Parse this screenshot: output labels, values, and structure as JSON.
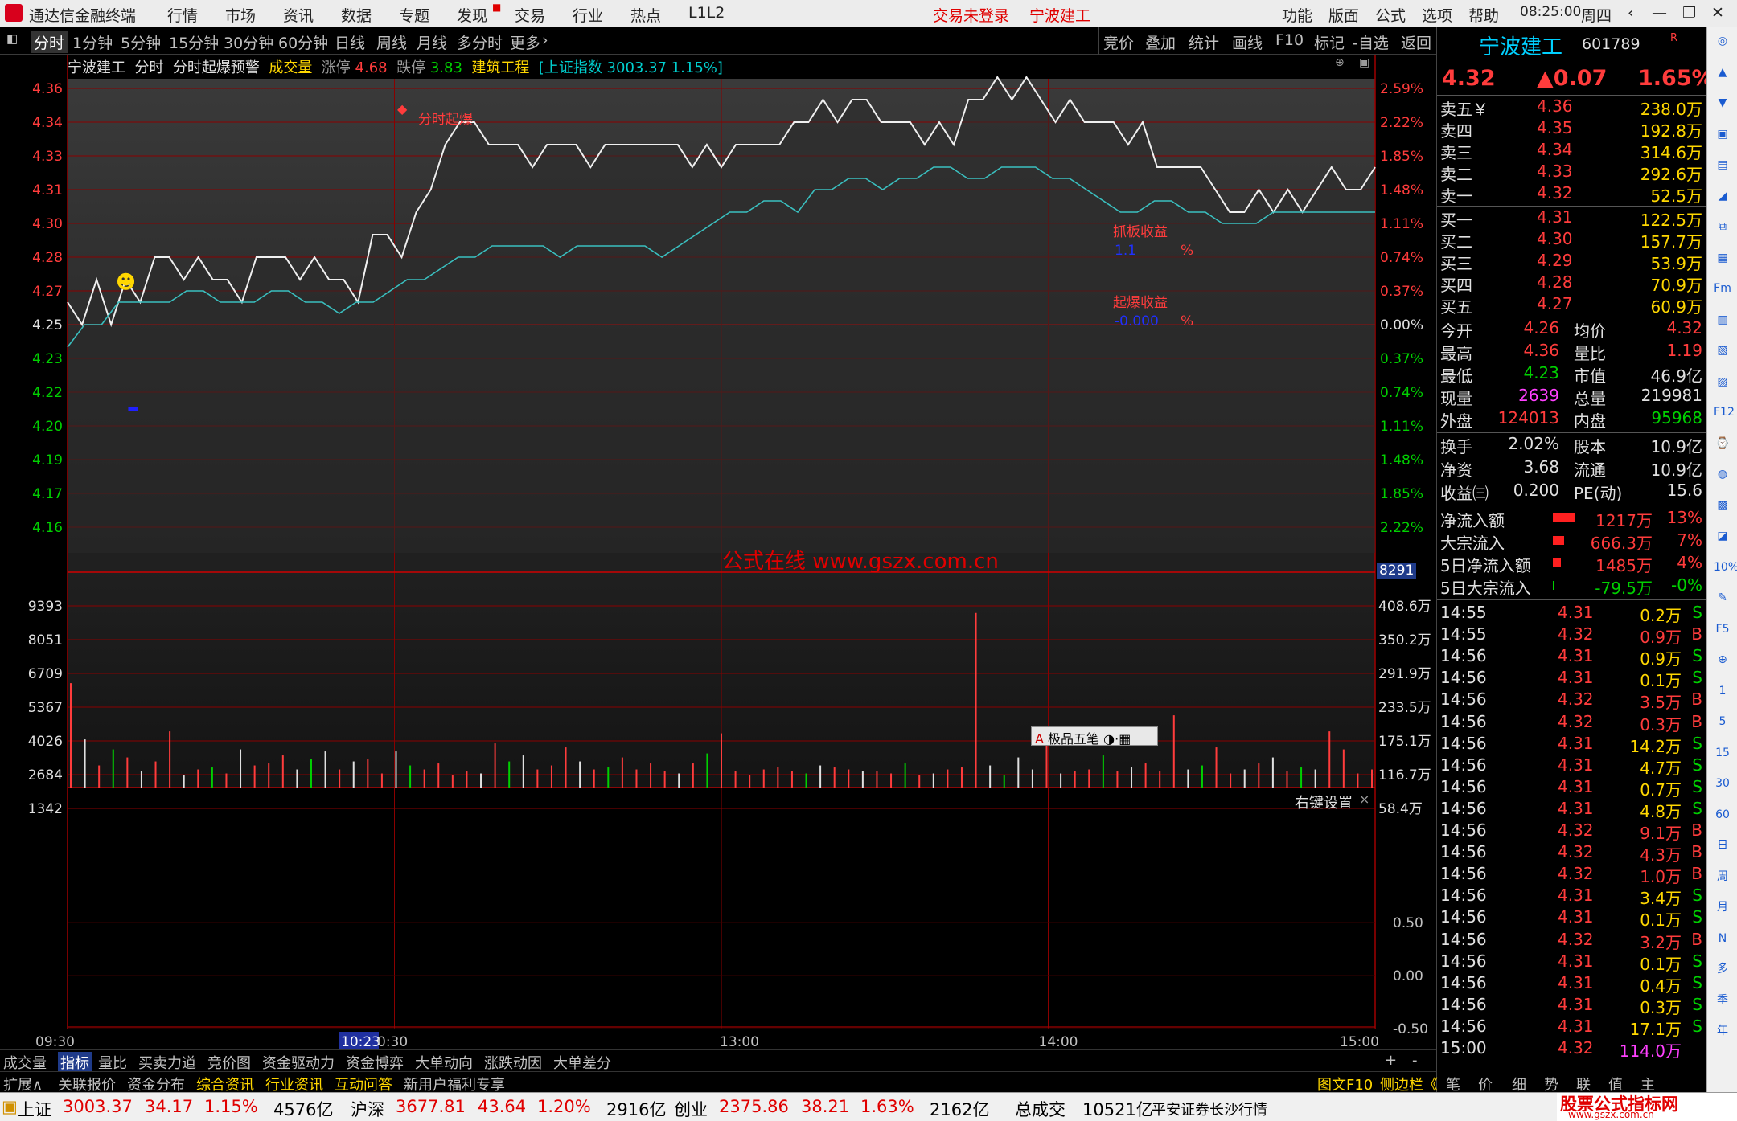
{
  "titlebar": {
    "app_title": "通达信金融终端",
    "menu": [
      "行情",
      "市场",
      "资讯",
      "数据",
      "专题",
      "发现",
      "交易",
      "行业",
      "热点",
      "L1L2"
    ],
    "login": "交易未登录",
    "stock": "宁波建工",
    "right_menu": [
      "功能",
      "版面",
      "公式",
      "选项",
      "帮助"
    ],
    "time": "08:25:00",
    "weekday": "周四"
  },
  "toolbar": {
    "periods": [
      "分时",
      "1分钟",
      "5分钟",
      "15分钟",
      "30分钟",
      "60分钟",
      "日线",
      "周线",
      "月线",
      "多分时",
      "更多"
    ],
    "actions": [
      "竞价",
      "叠加",
      "统计",
      "画线",
      "F10",
      "标记",
      "-自选",
      "返回"
    ]
  },
  "chart_header": {
    "name": "宁波建工",
    "period": "分时",
    "indicator": "分时起爆预警",
    "volume_label": "成交量",
    "limit_up_label": "涨停",
    "limit_up": "4.68",
    "limit_down_label": "跌停",
    "limit_down": "3.83",
    "industry": "建筑工程",
    "index_text": "[上证指数 3003.37 1.15%]"
  },
  "chart_labels": {
    "signal": "分时起爆",
    "grab_label": "抓板收益",
    "grab_value": "1.1",
    "burst_label": "起爆收益",
    "burst_value": "-0.000",
    "pct": "%",
    "watermark": "公式在线  www.gszx.com.cn",
    "cursor_vol": "8291",
    "ime": "极品五笔",
    "right_click": "右键设置"
  },
  "chart_data": {
    "type": "line",
    "price_ticks": [
      "4.36",
      "4.34",
      "4.33",
      "4.31",
      "4.30",
      "4.28",
      "4.27",
      "4.25",
      "4.23",
      "4.22",
      "4.20",
      "4.19",
      "4.17",
      "4.16"
    ],
    "pct_ticks": [
      "2.59%",
      "2.22%",
      "1.85%",
      "1.48%",
      "1.11%",
      "0.74%",
      "0.37%",
      "0.00%",
      "0.37%",
      "0.74%",
      "1.11%",
      "1.48%",
      "1.85%",
      "2.22%"
    ],
    "vol_ticks": [
      "9393",
      "8051",
      "6709",
      "5367",
      "4026",
      "2684",
      "1342"
    ],
    "vol_ticks_right": [
      "408.6万",
      "350.2万",
      "291.9万",
      "233.5万",
      "175.1万",
      "116.7万",
      "58.4万"
    ],
    "ind_ticks": [
      "0.50",
      "0.00",
      "-0.50"
    ],
    "time_ticks": [
      "09:30",
      "10:23",
      "0:30",
      "13:00",
      "14:00",
      "15:00"
    ],
    "prev_close": 4.25,
    "price_series": [
      4.26,
      4.25,
      4.27,
      4.25,
      4.27,
      4.26,
      4.28,
      4.28,
      4.27,
      4.28,
      4.27,
      4.27,
      4.26,
      4.28,
      4.28,
      4.28,
      4.27,
      4.28,
      4.27,
      4.27,
      4.26,
      4.29,
      4.29,
      4.28,
      4.3,
      4.31,
      4.33,
      4.34,
      4.34,
      4.33,
      4.33,
      4.33,
      4.32,
      4.33,
      4.33,
      4.33,
      4.32,
      4.33,
      4.33,
      4.33,
      4.33,
      4.33,
      4.33,
      4.32,
      4.33,
      4.32,
      4.33,
      4.33,
      4.33,
      4.33,
      4.34,
      4.34,
      4.35,
      4.34,
      4.35,
      4.35,
      4.34,
      4.34,
      4.34,
      4.33,
      4.34,
      4.33,
      4.35,
      4.35,
      4.36,
      4.35,
      4.36,
      4.35,
      4.34,
      4.35,
      4.34,
      4.34,
      4.34,
      4.33,
      4.34,
      4.32,
      4.32,
      4.32,
      4.32,
      4.31,
      4.3,
      4.3,
      4.31,
      4.3,
      4.31,
      4.3,
      4.31,
      4.32,
      4.31,
      4.31,
      4.32
    ],
    "avg_series": [
      4.24,
      4.25,
      4.25,
      4.26,
      4.26,
      4.26,
      4.26,
      4.265,
      4.265,
      4.26,
      4.26,
      4.26,
      4.265,
      4.265,
      4.26,
      4.26,
      4.255,
      4.26,
      4.26,
      4.265,
      4.27,
      4.27,
      4.275,
      4.28,
      4.28,
      4.285,
      4.285,
      4.285,
      4.285,
      4.28,
      4.285,
      4.285,
      4.285,
      4.285,
      4.285,
      4.28,
      4.285,
      4.29,
      4.295,
      4.3,
      4.3,
      4.305,
      4.305,
      4.3,
      4.31,
      4.31,
      4.315,
      4.315,
      4.31,
      4.315,
      4.315,
      4.32,
      4.32,
      4.315,
      4.315,
      4.32,
      4.32,
      4.32,
      4.315,
      4.315,
      4.31,
      4.305,
      4.3,
      4.3,
      4.305,
      4.305,
      4.3,
      4.3,
      4.295,
      4.295,
      4.295,
      4.3,
      4.3,
      4.3,
      4.3,
      4.3,
      4.3,
      4.3
    ],
    "volumes": [
      5200,
      2400,
      1100,
      1900,
      1500,
      800,
      1300,
      2800,
      600,
      900,
      1000,
      700,
      1900,
      1100,
      1200,
      1600,
      900,
      1400,
      1800,
      900,
      1300,
      1400,
      700,
      1800,
      1100,
      900,
      1200,
      600,
      800,
      700,
      2200,
      1300,
      1600,
      900,
      1100,
      2000,
      1300,
      900,
      1000,
      1500,
      900,
      1200,
      800,
      700,
      1200,
      1700,
      2700,
      800,
      600,
      900,
      1000,
      800,
      700,
      1100,
      1000,
      900,
      800,
      800,
      700,
      1200,
      600,
      700,
      900,
      1000,
      8700,
      1100,
      600,
      1500,
      900,
      2500,
      700,
      800,
      900,
      1600,
      800,
      1000,
      1200,
      800,
      3600,
      900,
      1100,
      2000,
      700,
      900,
      1200,
      1500,
      800,
      1000,
      900,
      2800,
      1900,
      700,
      900
    ],
    "ind_range": [
      -0.7,
      0.95
    ]
  },
  "quote": {
    "name": "宁波建工",
    "code": "601789",
    "code_mark": "R",
    "price": "4.32",
    "change": "▲0.07",
    "pct": "1.65%",
    "asks": [
      {
        "l": "卖五￥",
        "p": "4.36",
        "v": "238.0万"
      },
      {
        "l": "卖四",
        "p": "4.35",
        "v": "192.8万"
      },
      {
        "l": "卖三",
        "p": "4.34",
        "v": "314.6万"
      },
      {
        "l": "卖二",
        "p": "4.33",
        "v": "292.6万"
      },
      {
        "l": "卖一",
        "p": "4.32",
        "v": "52.5万"
      }
    ],
    "bids": [
      {
        "l": "买一",
        "p": "4.31",
        "v": "122.5万"
      },
      {
        "l": "买二",
        "p": "4.30",
        "v": "157.7万"
      },
      {
        "l": "买三",
        "p": "4.29",
        "v": "53.9万"
      },
      {
        "l": "买四",
        "p": "4.28",
        "v": "70.9万"
      },
      {
        "l": "买五",
        "p": "4.27",
        "v": "60.9万"
      }
    ],
    "stats": [
      {
        "a": "今开",
        "b": "4.26",
        "c": "均价",
        "d": "4.32"
      },
      {
        "a": "最高",
        "b": "4.36",
        "c": "量比",
        "d": "1.19"
      },
      {
        "a": "最低",
        "b": "4.23",
        "c": "市值",
        "d": "46.9亿"
      },
      {
        "a": "现量",
        "b": "2639",
        "c": "总量",
        "d": "219981"
      },
      {
        "a": "外盘",
        "b": "124013",
        "c": "内盘",
        "d": "95968"
      }
    ],
    "stats2": [
      {
        "a": "换手",
        "b": "2.02%",
        "c": "股本",
        "d": "10.9亿"
      },
      {
        "a": "净资",
        "b": "3.68",
        "c": "流通",
        "d": "10.9亿"
      },
      {
        "a": "收益㈢",
        "b": "0.200",
        "c": "PE(动)",
        "d": "15.6"
      }
    ],
    "flows": [
      {
        "l": "净流入额",
        "v": "1217万",
        "p": "13%"
      },
      {
        "l": "大宗流入",
        "v": "666.3万",
        "p": "7%"
      },
      {
        "l": "5日净流入额",
        "v": "1485万",
        "p": "4%"
      },
      {
        "l": "5日大宗流入",
        "v": "-79.5万",
        "p": "-0%"
      }
    ],
    "ticks": [
      {
        "t": "14:55",
        "p": "4.31",
        "v": "0.2万",
        "s": "S"
      },
      {
        "t": "14:55",
        "p": "4.32",
        "v": "0.9万",
        "s": "B"
      },
      {
        "t": "14:56",
        "p": "4.31",
        "v": "0.9万",
        "s": "S"
      },
      {
        "t": "14:56",
        "p": "4.31",
        "v": "0.1万",
        "s": "S"
      },
      {
        "t": "14:56",
        "p": "4.32",
        "v": "3.5万",
        "s": "B"
      },
      {
        "t": "14:56",
        "p": "4.32",
        "v": "0.3万",
        "s": "B"
      },
      {
        "t": "14:56",
        "p": "4.31",
        "v": "14.2万",
        "s": "S"
      },
      {
        "t": "14:56",
        "p": "4.31",
        "v": "4.7万",
        "s": "S"
      },
      {
        "t": "14:56",
        "p": "4.31",
        "v": "0.7万",
        "s": "S"
      },
      {
        "t": "14:56",
        "p": "4.31",
        "v": "4.8万",
        "s": "S"
      },
      {
        "t": "14:56",
        "p": "4.32",
        "v": "9.1万",
        "s": "B"
      },
      {
        "t": "14:56",
        "p": "4.32",
        "v": "4.3万",
        "s": "B"
      },
      {
        "t": "14:56",
        "p": "4.32",
        "v": "1.0万",
        "s": "B"
      },
      {
        "t": "14:56",
        "p": "4.31",
        "v": "3.4万",
        "s": "S"
      },
      {
        "t": "14:56",
        "p": "4.31",
        "v": "0.1万",
        "s": "S"
      },
      {
        "t": "14:56",
        "p": "4.32",
        "v": "3.2万",
        "s": "B"
      },
      {
        "t": "14:56",
        "p": "4.31",
        "v": "0.1万",
        "s": "S"
      },
      {
        "t": "14:56",
        "p": "4.31",
        "v": "0.4万",
        "s": "S"
      },
      {
        "t": "14:56",
        "p": "4.31",
        "v": "0.3万",
        "s": "S"
      },
      {
        "t": "14:56",
        "p": "4.31",
        "v": "17.1万",
        "s": "S"
      },
      {
        "t": "15:00",
        "p": "4.32",
        "v": "114.0万",
        "s": ""
      }
    ]
  },
  "tabs1": [
    "成交量",
    "指标",
    "量比",
    "买卖力道",
    "竞价图",
    "资金驱动力",
    "资金博弈",
    "大单动向",
    "涨跌动因",
    "大单差分"
  ],
  "tabs1_right": [
    "+",
    "-"
  ],
  "tabs2": [
    "扩展∧",
    "关联报价",
    "资金分布",
    "综合资讯",
    "行业资讯",
    "互动问答",
    "新用户福利专享"
  ],
  "tabs2_right": [
    "图文F10",
    "侧边栏《",
    "笔",
    "价",
    "细",
    "势",
    "联",
    "值",
    "主"
  ],
  "side_icons": [
    "◎",
    "▲",
    "▼",
    "▣",
    "▤",
    "◢",
    "⧉",
    "▦",
    "Fm",
    "▥",
    "▧",
    "▨",
    "F12",
    "⌚",
    "◍",
    "▩",
    "◪",
    "10%",
    "✎",
    "F5",
    "⊕",
    "1",
    "5",
    "15",
    "30",
    "60",
    "日",
    "周",
    "月",
    "N",
    "多",
    "季",
    "年"
  ],
  "status": {
    "items": [
      {
        "n": "上证",
        "p": "3003.37",
        "c": "34.17",
        "pc": "1.15%",
        "v": "4576亿"
      },
      {
        "n": "沪深",
        "p": "3677.81",
        "c": "43.64",
        "pc": "1.20%",
        "v": "2916亿"
      },
      {
        "n": "创业",
        "p": "2375.86",
        "c": "38.21",
        "pc": "1.63%",
        "v": "2162亿"
      }
    ],
    "total_label": "总成交",
    "total": "10521亿",
    "broker": "平安证券长沙行情",
    "brand": "股票公式指标网",
    "brand_url": "www.gszx.com.cn"
  }
}
